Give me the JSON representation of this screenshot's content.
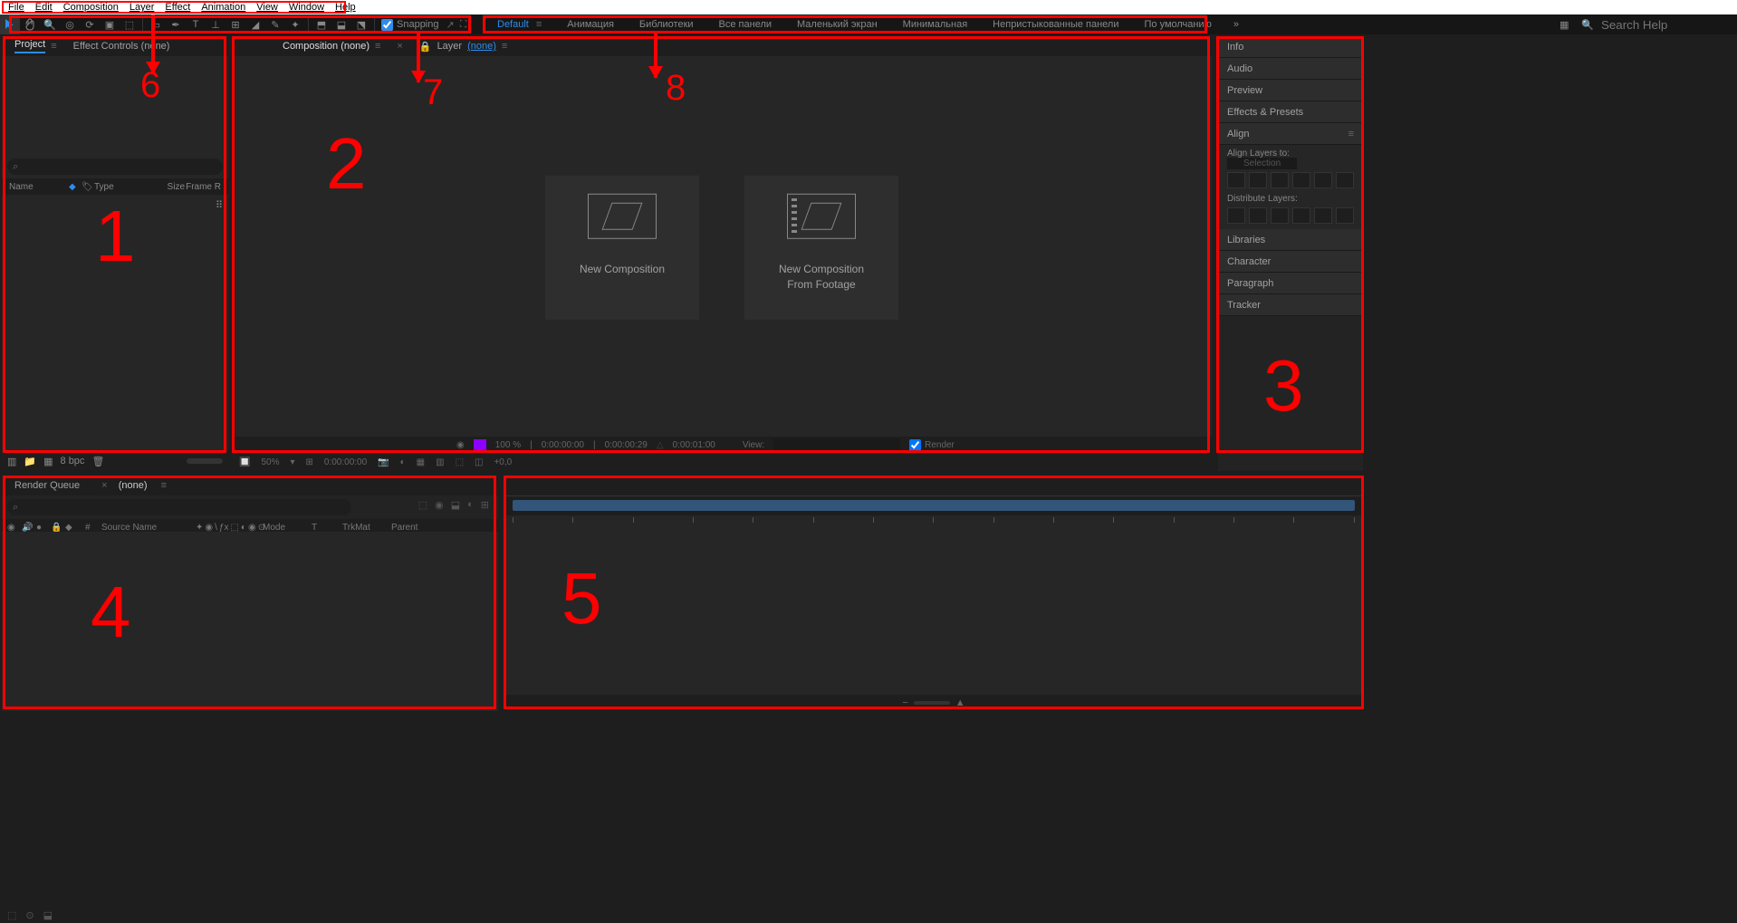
{
  "menu": [
    "File",
    "Edit",
    "Composition",
    "Layer",
    "Effect",
    "Animation",
    "View",
    "Window",
    "Help"
  ],
  "toolbar": {
    "snapping_label": "Snapping"
  },
  "workspaces": {
    "items": [
      "Default",
      "Анимация",
      "Библиотеки",
      "Все панели",
      "Маленький экран",
      "Минимальная",
      "Непристыкованные панели",
      "По умолчанию"
    ],
    "active_index": 0,
    "more": "»"
  },
  "search": {
    "placeholder": "Search Help"
  },
  "project": {
    "tab_project": "Project",
    "tab_effect_controls": "Effect Controls (none)",
    "search_icon": "⌕",
    "columns": {
      "name": "Name",
      "type": "Type",
      "size": "Size",
      "frame": "Frame R"
    },
    "footer_bpc": "8 bpc"
  },
  "composition": {
    "tab_comp": "Composition (none)",
    "tab_layer_prefix": "Layer",
    "tab_layer_value": "(none)",
    "new_comp": "New Composition",
    "new_comp_footage_l1": "New Composition",
    "new_comp_footage_l2": "From Footage",
    "footer": {
      "percent": "100 %",
      "t1": "0:00:00:00",
      "t2": "0:00:00:29",
      "t3": "0:00:01:00",
      "view": "View:",
      "render": "Render"
    },
    "viewer_footer": {
      "zoom": "50%",
      "time": "0:00:00:00",
      "offset": "+0,0"
    }
  },
  "right_panels": {
    "info": "Info",
    "audio": "Audio",
    "preview": "Preview",
    "ep": "Effects & Presets",
    "align": "Align",
    "align_to": "Align Layers to:",
    "align_sel": "Selection",
    "distribute": "Distribute Layers:",
    "libraries": "Libraries",
    "character": "Character",
    "paragraph": "Paragraph",
    "tracker": "Tracker"
  },
  "timeline": {
    "tab_rq": "Render Queue",
    "tab_none": "(none)",
    "search_icon": "⌕",
    "cols": {
      "num": "#",
      "source": "Source Name",
      "mode": "Mode",
      "t": "T",
      "trkmat": "TrkMat",
      "parent": "Parent"
    }
  },
  "annotations": {
    "n1": "1",
    "n2": "2",
    "n3": "3",
    "n4": "4",
    "n5": "5",
    "n6": "6",
    "n7": "7",
    "n8": "8"
  }
}
